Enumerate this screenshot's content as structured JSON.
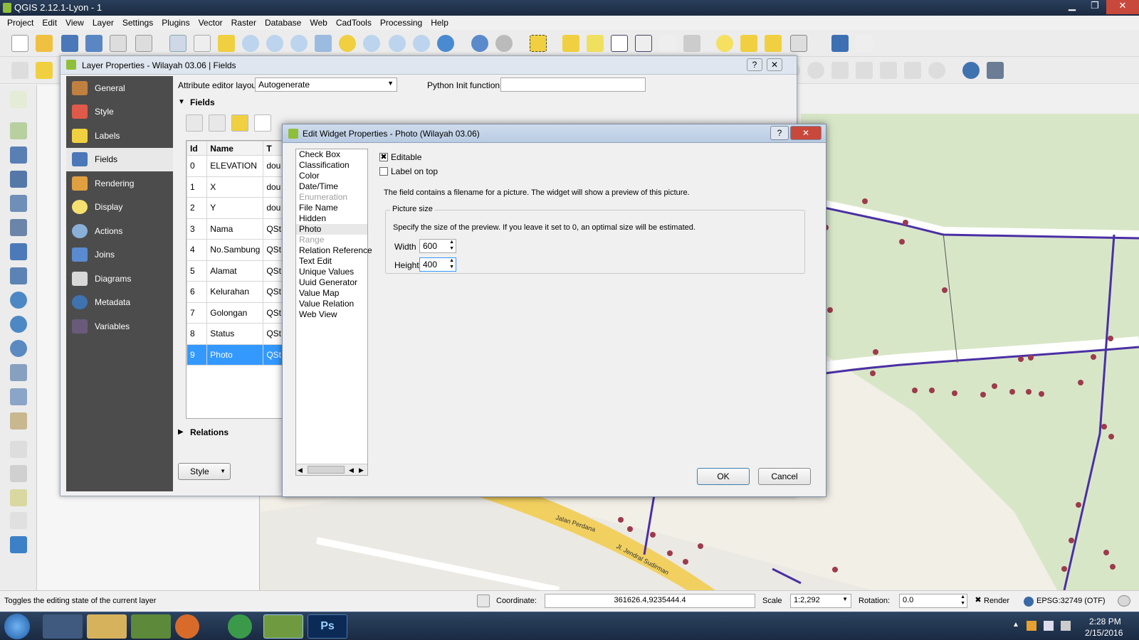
{
  "window": {
    "title": "QGIS 2.12.1-Lyon - 1"
  },
  "menu": [
    "Project",
    "Edit",
    "View",
    "Layer",
    "Settings",
    "Plugins",
    "Vector",
    "Raster",
    "Database",
    "Web",
    "CadTools",
    "Processing",
    "Help"
  ],
  "layer_props": {
    "title": "Layer Properties - Wilayah 03.06 | Fields",
    "side_items": [
      "General",
      "Style",
      "Labels",
      "Fields",
      "Rendering",
      "Display",
      "Actions",
      "Joins",
      "Diagrams",
      "Metadata",
      "Variables"
    ],
    "selected_side": "Fields",
    "editor_layout_label": "Attribute editor layout:",
    "editor_layout_value": "Autogenerate",
    "python_init_label": "Python Init function",
    "fields_header": "Fields",
    "relations_header": "Relations",
    "style_btn": "Style",
    "table": {
      "columns": [
        "Id",
        "Name",
        "T"
      ],
      "rows": [
        {
          "id": "0",
          "name": "ELEVATION",
          "type": "dou"
        },
        {
          "id": "1",
          "name": "X",
          "type": "dou"
        },
        {
          "id": "2",
          "name": "Y",
          "type": "dou"
        },
        {
          "id": "3",
          "name": "Nama",
          "type": "QSt"
        },
        {
          "id": "4",
          "name": "No.Sambung",
          "type": "QSt"
        },
        {
          "id": "5",
          "name": "Alamat",
          "type": "QSt"
        },
        {
          "id": "6",
          "name": "Kelurahan",
          "type": "QSt"
        },
        {
          "id": "7",
          "name": "Golongan",
          "type": "QSt"
        },
        {
          "id": "8",
          "name": "Status",
          "type": "QSt"
        },
        {
          "id": "9",
          "name": "Photo",
          "type": "QSt"
        }
      ]
    }
  },
  "edit_widget": {
    "title": "Edit Widget Properties - Photo (Wilayah 03.06)",
    "help_btn": "?",
    "close_btn": "✕",
    "widgets": [
      {
        "label": "Check Box",
        "state": "normal"
      },
      {
        "label": "Classification",
        "state": "normal"
      },
      {
        "label": "Color",
        "state": "normal"
      },
      {
        "label": "Date/Time",
        "state": "normal"
      },
      {
        "label": "Enumeration",
        "state": "disabled"
      },
      {
        "label": "File Name",
        "state": "normal"
      },
      {
        "label": "Hidden",
        "state": "normal"
      },
      {
        "label": "Photo",
        "state": "selected"
      },
      {
        "label": "Range",
        "state": "disabled"
      },
      {
        "label": "Relation Reference",
        "state": "normal"
      },
      {
        "label": "Text Edit",
        "state": "normal"
      },
      {
        "label": "Unique Values",
        "state": "normal"
      },
      {
        "label": "Uuid Generator",
        "state": "normal"
      },
      {
        "label": "Value Map",
        "state": "normal"
      },
      {
        "label": "Value Relation",
        "state": "normal"
      },
      {
        "label": "Web View",
        "state": "normal"
      }
    ],
    "editable_label": "Editable",
    "editable_checked": "✖",
    "label_on_top": "Label on top",
    "description": "The field contains a filename for a picture. The widget will show a preview of this picture.",
    "picture_size_title": "Picture size",
    "picture_size_desc": "Specify the size of the preview. If you leave it set to 0, an optimal size will be estimated.",
    "width_label": "Width",
    "width_value": "600",
    "height_label": "Height",
    "height_value": "400",
    "ok": "OK",
    "cancel": "Cancel"
  },
  "map_labels": [
    "Jalan Perdana",
    "Jl. Jendral Sudirman"
  ],
  "status": {
    "message": "Toggles the editing state of the current layer",
    "coordinate_label": "Coordinate:",
    "coordinate_value": "361626.4,9235444.4",
    "scale_label": "Scale",
    "scale_value": "1:2,292",
    "rotation_label": "Rotation:",
    "rotation_value": "0.0",
    "render_label": "Render",
    "render_checked": "✖",
    "crs": "EPSG:32749 (OTF)"
  },
  "taskbar": {
    "time": "2:28 PM",
    "date": "2/15/2016",
    "ps_label": "Ps"
  },
  "colors": {
    "accent": "#3399ff",
    "map_road": "#4b2fa5",
    "map_point": "#9c3b4c",
    "map_green": "#d8e6c8",
    "map_yellow": "#f2d060"
  }
}
